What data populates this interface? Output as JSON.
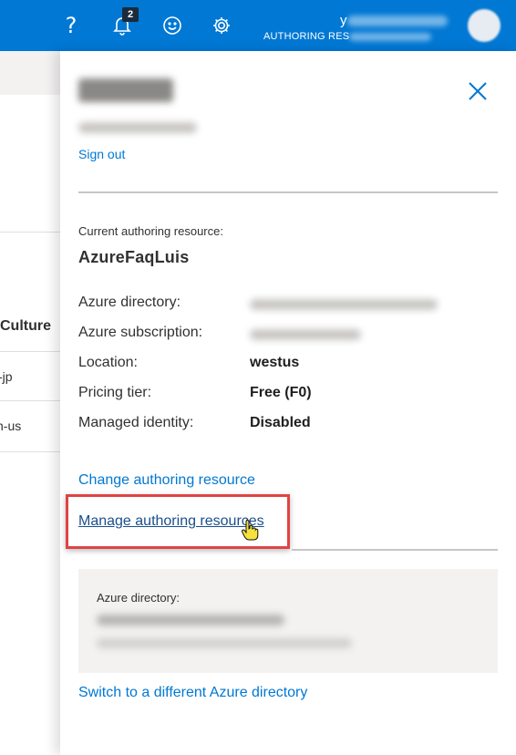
{
  "topbar": {
    "help_icon": "?",
    "notification_count": "2",
    "user_initial": "y",
    "user_role": "AUTHORING RES",
    "bg_color": "#0078d4"
  },
  "left": {
    "column_header": "Culture",
    "rows": [
      "-jp",
      "n-us"
    ]
  },
  "panel": {
    "sign_out": "Sign out",
    "current_label": "Current authoring resource:",
    "resource_name": "AzureFaqLuis",
    "details": [
      {
        "key": "Azure directory:",
        "value": ""
      },
      {
        "key": "Azure subscription:",
        "value": ""
      },
      {
        "key": "Location:",
        "value": "westus"
      },
      {
        "key": "Pricing tier:",
        "value": "Free (F0)"
      },
      {
        "key": "Managed identity:",
        "value": "Disabled"
      }
    ],
    "change_link": "Change authoring resource",
    "manage_link": "Manage authoring resources",
    "directory_box_label": "Azure directory:",
    "switch_link": "Switch to a different Azure directory",
    "link_color": "#0078d4",
    "highlight_color": "#e04343"
  }
}
